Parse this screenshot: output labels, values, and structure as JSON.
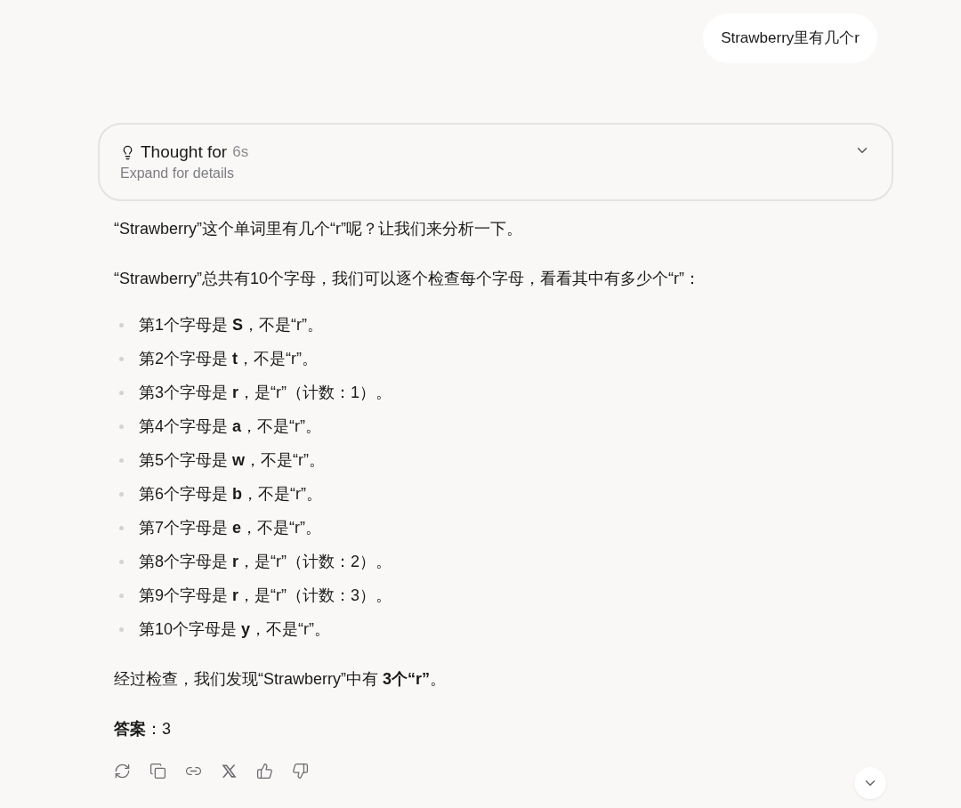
{
  "user_message": "Strawberry里有几个r",
  "thought": {
    "title": "Thought for",
    "duration": "6s",
    "hint": "Expand for details",
    "expanded": false
  },
  "paragraphs": [
    "“Strawberry”这个单词里有几个“r”呢？让我们来分析一下。",
    "“Strawberry”总共有10个字母，我们可以逐个检查每个字母，看看其中有多少个“r”："
  ],
  "list": [
    "第1个字母是 **S**，不是“r”。",
    "第2个字母是 **t**，不是“r”。",
    "第3个字母是 **r**，是“r”（计数：1）。",
    "第4个字母是 **a**，不是“r”。",
    "第5个字母是 **w**，不是“r”。",
    "第6个字母是 **b**，不是“r”。",
    "第7个字母是 **e**，不是“r”。",
    "第8个字母是 **r**，是“r”（计数：2）。",
    "第9个字母是 **r**，是“r”（计数：3）。",
    "第10个字母是 **y**，不是“r”。"
  ],
  "conclusion": "经过检查，我们发现“Strawberry”中有 **3个“r”**。",
  "answer": "**答案**：3",
  "actions": [
    {
      "kind": "regenerate"
    },
    {
      "kind": "copy"
    },
    {
      "kind": "link"
    },
    {
      "kind": "share-x"
    },
    {
      "kind": "like"
    },
    {
      "kind": "dislike"
    }
  ]
}
